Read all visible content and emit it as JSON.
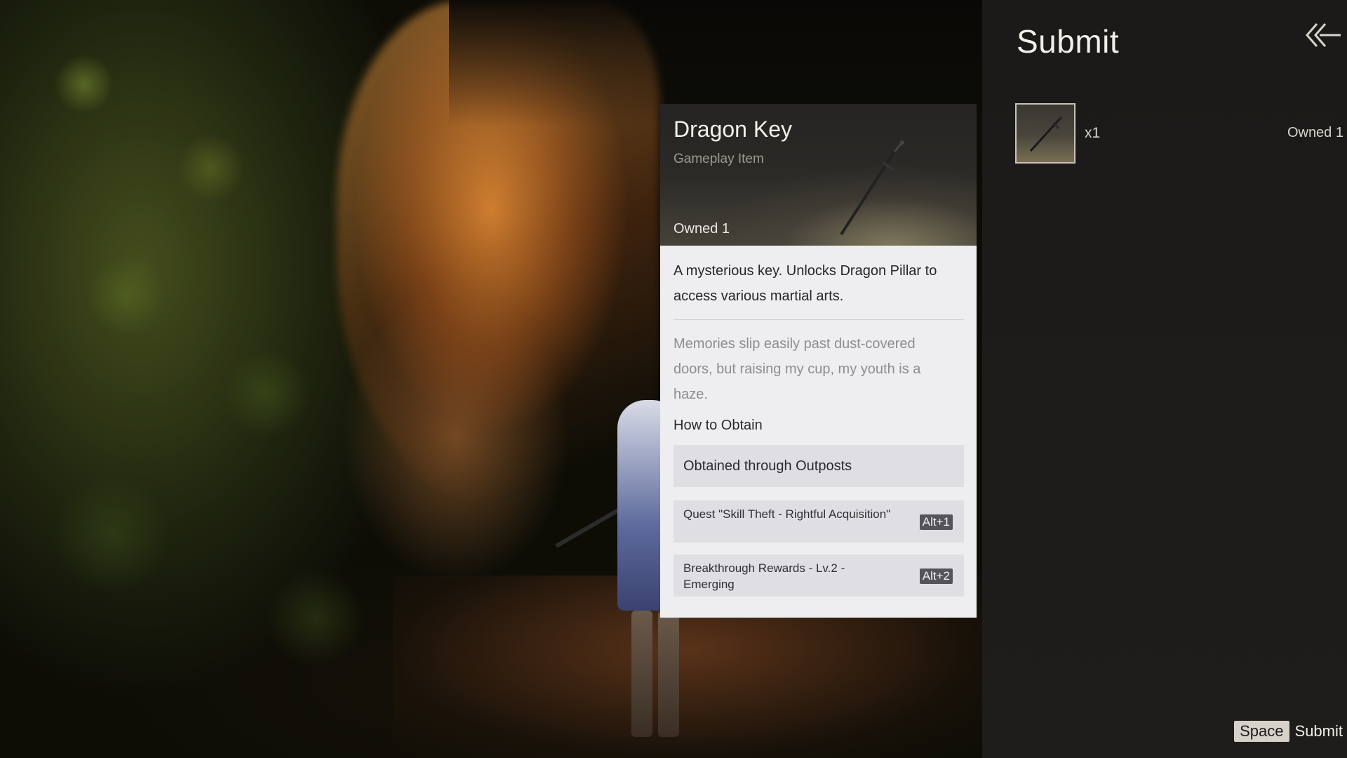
{
  "panel": {
    "title": "Submit",
    "slot": {
      "quantity": "x1",
      "owned": "Owned 1"
    },
    "hint": {
      "key": "Space",
      "label": "Submit"
    }
  },
  "item": {
    "name": "Dragon Key",
    "type": "Gameplay Item",
    "owned": "Owned 1",
    "description": "A mysterious key. Unlocks Dragon Pillar to access various martial arts.",
    "flavor": "Memories slip easily past dust-covered doors, but raising my cup, my youth is a haze.",
    "how_to_obtain_label": "How to Obtain",
    "sources_header": "Obtained through Outposts",
    "sources": [
      {
        "label": "Quest \"Skill Theft - Rightful Acquisition\"",
        "key": "Alt+1"
      },
      {
        "label": "Breakthrough Rewards - Lv.2 - Emerging",
        "key": "Alt+2"
      }
    ]
  },
  "icons": {
    "back": "double-chevron-left-icon",
    "item": "dagger-key-icon"
  }
}
